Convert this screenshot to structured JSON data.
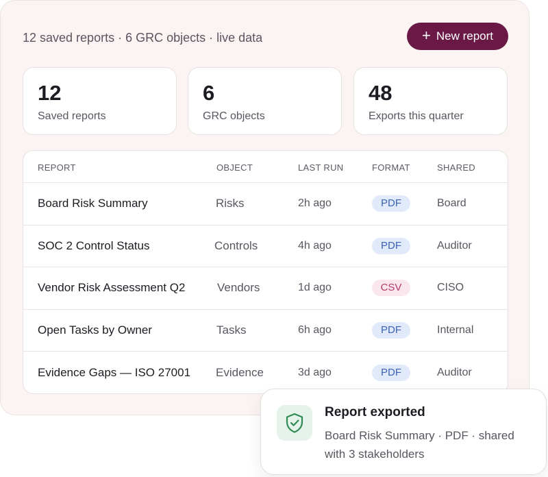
{
  "summary": "12 saved reports · 6 GRC objects · live data",
  "new_report_label": "New report",
  "stats": [
    {
      "value": "12",
      "label": "Saved reports"
    },
    {
      "value": "6",
      "label": "GRC objects"
    },
    {
      "value": "48",
      "label": "Exports this quarter"
    }
  ],
  "table": {
    "headers": [
      "REPORT",
      "OBJECT",
      "LAST RUN",
      "FORMAT",
      "SHARED"
    ],
    "rows": [
      {
        "report": "Board Risk Summary",
        "object": "Risks",
        "last_run": "2h ago",
        "format": "PDF",
        "shared": "Board"
      },
      {
        "report": "SOC 2 Control Status",
        "object": "Controls",
        "last_run": "4h ago",
        "format": "PDF",
        "shared": "Auditor"
      },
      {
        "report": "Vendor Risk Assessment Q2",
        "object": "Vendors",
        "last_run": "1d ago",
        "format": "CSV",
        "shared": "CISO"
      },
      {
        "report": "Open Tasks by Owner",
        "object": "Tasks",
        "last_run": "6h ago",
        "format": "PDF",
        "shared": "Internal"
      },
      {
        "report": "Evidence Gaps — ISO 27001",
        "object": "Evidence",
        "last_run": "3d ago",
        "format": "PDF",
        "shared": "Auditor"
      }
    ]
  },
  "toast": {
    "title": "Report exported",
    "body": "Board Risk Summary · PDF · shared with 3 stakeholders",
    "icon": "shield-check-icon"
  },
  "colors": {
    "brand": "#6a1845",
    "panel_bg": "#fbf4f2",
    "pdf_badge": "#e1eafa",
    "csv_badge": "#fbe6ee",
    "success": "#2f8a55"
  }
}
